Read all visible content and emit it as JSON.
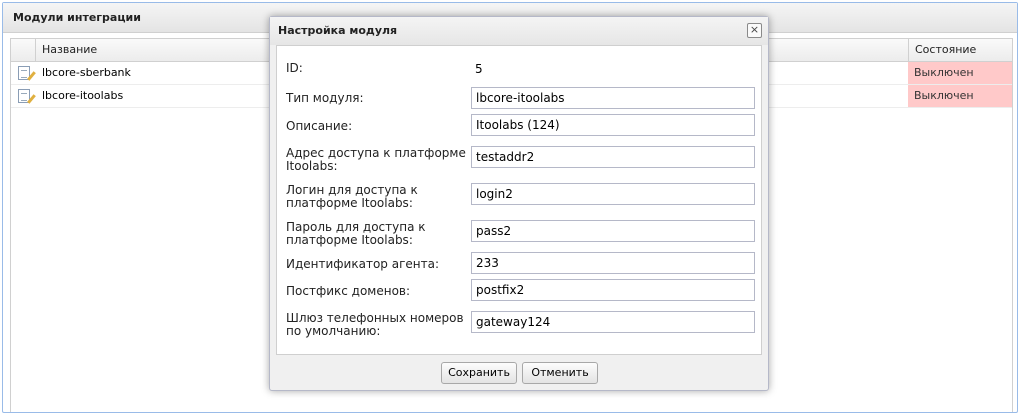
{
  "panel": {
    "title": "Модули интеграции"
  },
  "grid": {
    "columns": {
      "name": "Название",
      "state": "Состояние"
    },
    "rows": [
      {
        "name": "lbcore-sberbank",
        "state": "Выключен"
      },
      {
        "name": "lbcore-itoolabs",
        "state": "Выключен"
      }
    ],
    "state_color": "#ffc9c9"
  },
  "dialog": {
    "title": "Настройка модуля",
    "close": "×",
    "id_label": "ID:",
    "id_value": "5",
    "fields": [
      {
        "label": "Тип модуля:",
        "value": "lbcore-itoolabs"
      },
      {
        "label": "Описание:",
        "value": "Itoolabs (124)"
      },
      {
        "label": "Адрес доступа к платформе Itoolabs:",
        "value": "testaddr2"
      },
      {
        "label": "Логин для доступа к платформе Itoolabs:",
        "value": "login2"
      },
      {
        "label": "Пароль для доступа к платформе Itoolabs:",
        "value": "pass2"
      },
      {
        "label": "Идентификатор агента:",
        "value": "233"
      },
      {
        "label": "Постфикс доменов:",
        "value": "postfix2"
      },
      {
        "label": "Шлюз телефонных номеров по умолчанию:",
        "value": "gateway124"
      }
    ],
    "save_label": "Сохранить",
    "cancel_label": "Отменить"
  }
}
